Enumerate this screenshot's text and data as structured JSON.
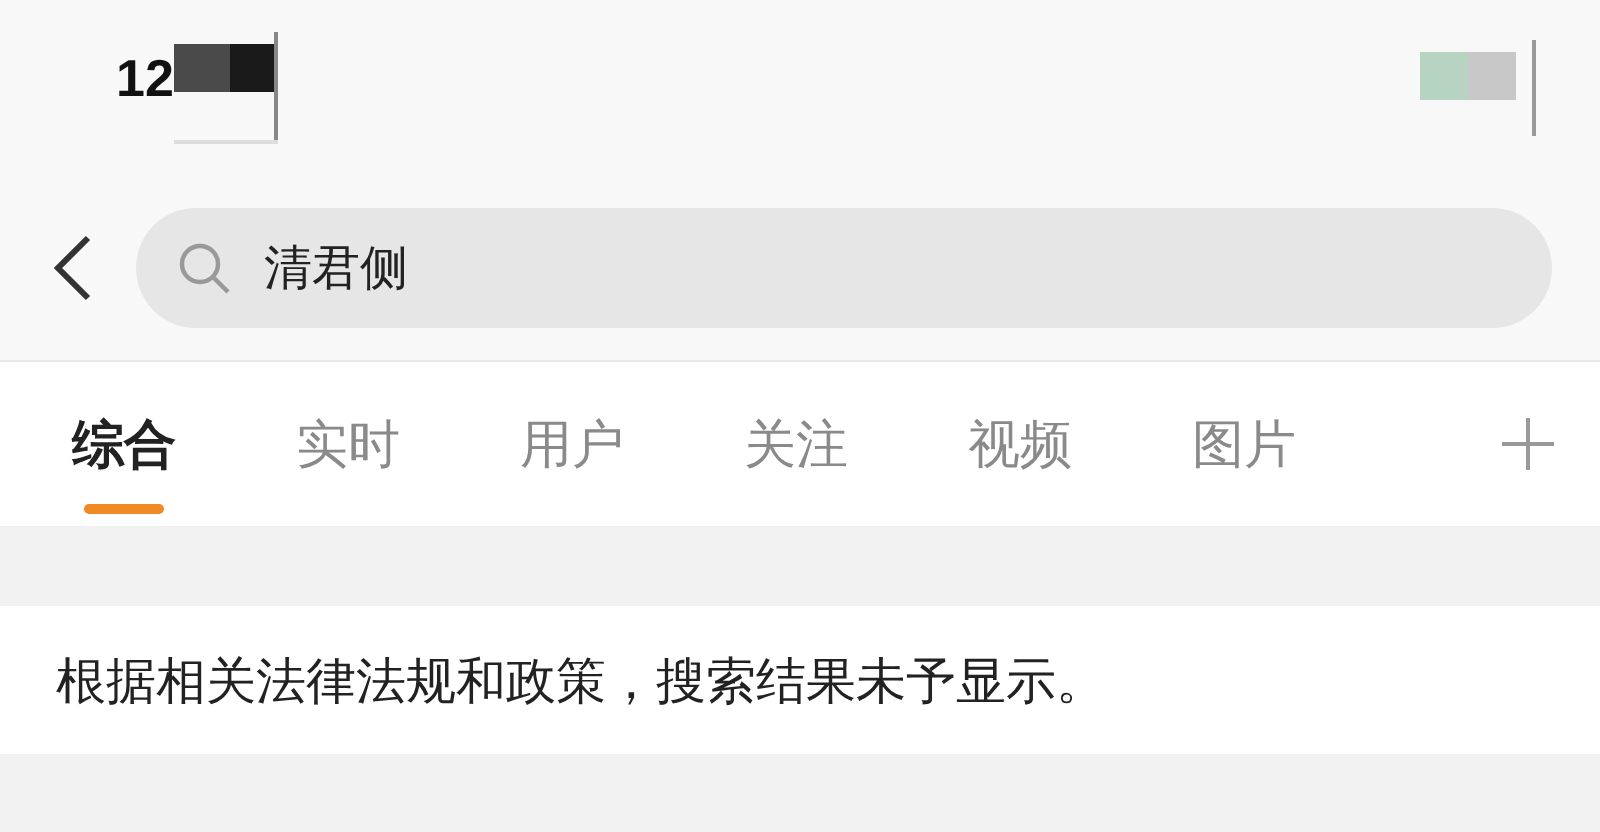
{
  "status_bar": {
    "time": "12"
  },
  "search": {
    "value": "清君侧"
  },
  "tabs": [
    {
      "label": "综合",
      "selected": true
    },
    {
      "label": "实时",
      "selected": false
    },
    {
      "label": "用户",
      "selected": false
    },
    {
      "label": "关注",
      "selected": false
    },
    {
      "label": "视频",
      "selected": false
    },
    {
      "label": "图片",
      "selected": false
    }
  ],
  "notice": "根据相关法律法规和政策，搜索结果未予显示。"
}
